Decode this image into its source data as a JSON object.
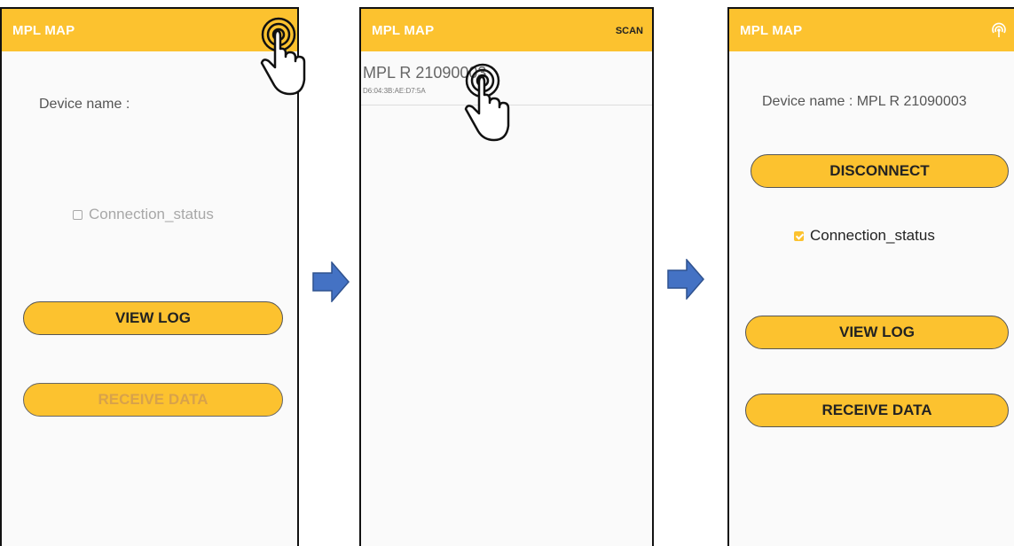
{
  "app_title": "MPL MAP",
  "screen1": {
    "device_name_label": "Device name :",
    "connection_status": "Connection_status",
    "view_log": "VIEW LOG",
    "receive_data": "RECEIVE DATA"
  },
  "screen2": {
    "scan_label": "SCAN",
    "device_name": "MPL R 21090003",
    "device_address": "D6:04:3B:AE:D7:5A"
  },
  "screen3": {
    "device_name_label": "Device name : MPL R 21090003",
    "disconnect": "DISCONNECT",
    "connection_status": "Connection_status",
    "connection_checked": true,
    "view_log": "VIEW LOG",
    "receive_data": "RECEIVE DATA"
  },
  "colors": {
    "appbar": "#fcc22f",
    "arrow": "#4472c4",
    "button": "#fcc22f"
  },
  "icons": [
    "bluetooth-searching-icon",
    "tap-hand-icon",
    "right-arrow-icon",
    "checkbox-icon"
  ]
}
